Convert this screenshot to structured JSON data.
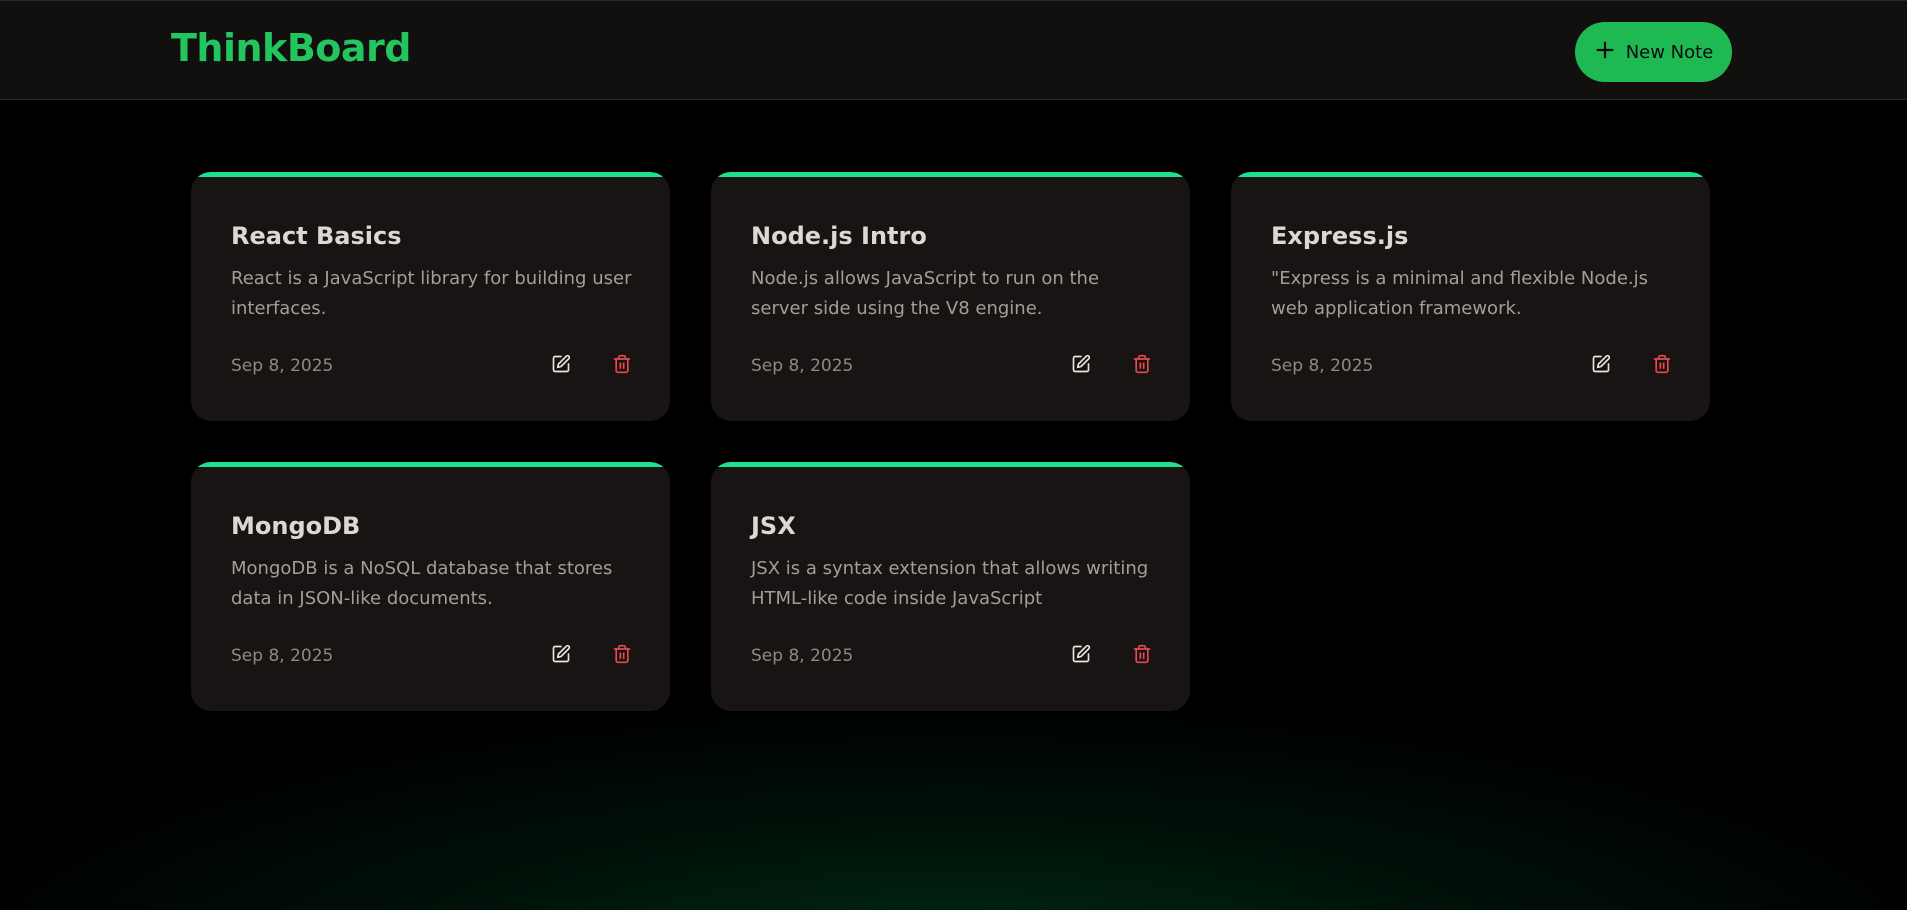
{
  "app": {
    "brand": "ThinkBoard",
    "new_note_label": "New Note"
  },
  "notes": [
    {
      "title": "React Basics",
      "content": "React is a JavaScript library for building user interfaces.",
      "date": "Sep 8, 2025"
    },
    {
      "title": "Node.js Intro",
      "content": "Node.js allows JavaScript to run on the server side using the V8 engine.",
      "date": "Sep 8, 2025"
    },
    {
      "title": "Express.js",
      "content": "\"Express is a minimal and flexible Node.js web application framework.",
      "date": "Sep 8, 2025"
    },
    {
      "title": "MongoDB",
      "content": "MongoDB is a NoSQL database that stores data in JSON-like documents.",
      "date": "Sep 8, 2025"
    },
    {
      "title": "JSX",
      "content": "JSX is a syntax extension that allows writing HTML-like code inside JavaScript",
      "date": "Sep 8, 2025"
    }
  ],
  "icons": {
    "new": "plus-icon",
    "edit": "pen-square-icon",
    "delete": "trash-icon"
  },
  "colors": {
    "accent": "#22c55e",
    "card_top_border": "#1ee08f",
    "delete_icon": "#e5484d",
    "card_background": "#171413",
    "navbar_background": "#12100f"
  }
}
